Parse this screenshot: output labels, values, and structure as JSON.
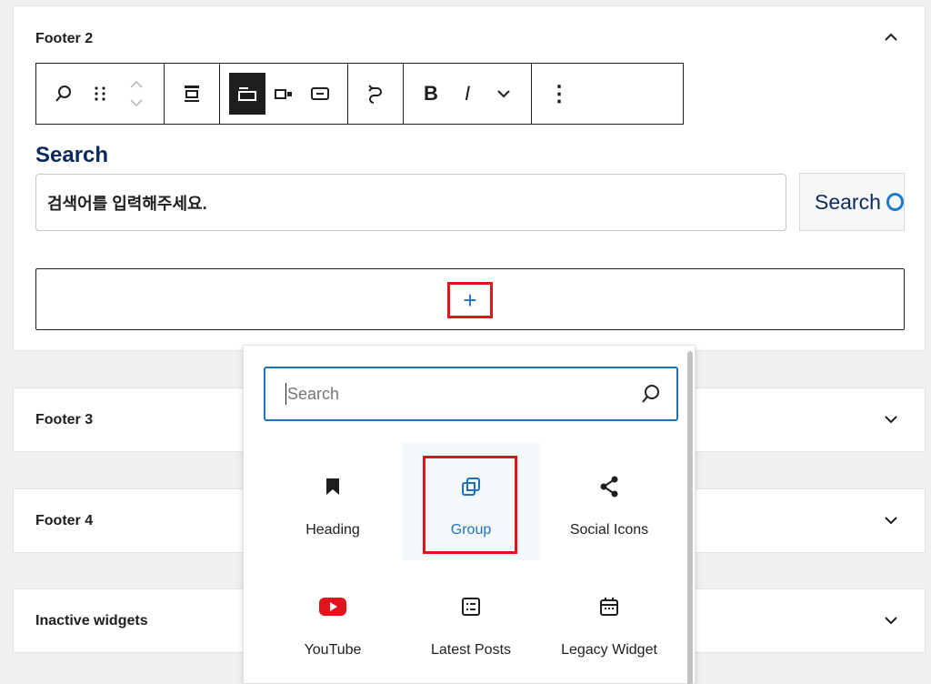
{
  "panels": {
    "footer2": {
      "title": "Footer 2"
    },
    "footer3": {
      "title": "Footer 3"
    },
    "footer4": {
      "title": "Footer 4"
    },
    "inactive": {
      "title": "Inactive widgets"
    }
  },
  "search_block": {
    "label": "Search",
    "input_value": "검색어를 입력해주세요.",
    "button_label": "Search"
  },
  "appender": {
    "symbol": "+"
  },
  "inserter": {
    "search_placeholder": "Search",
    "blocks": [
      {
        "label": "Heading",
        "icon": "bookmark-icon"
      },
      {
        "label": "Group",
        "icon": "group-icon"
      },
      {
        "label": "Social Icons",
        "icon": "share-icon"
      },
      {
        "label": "YouTube",
        "icon": "youtube-icon"
      },
      {
        "label": "Latest Posts",
        "icon": "list-icon"
      },
      {
        "label": "Legacy Widget",
        "icon": "calendar-icon"
      }
    ]
  },
  "toolbar": {
    "bold": "B",
    "italic": "I",
    "more": "⋮"
  },
  "colors": {
    "accent": "#1e72bd",
    "highlight": "#e3131c",
    "title_navy": "#0a2a5e"
  }
}
